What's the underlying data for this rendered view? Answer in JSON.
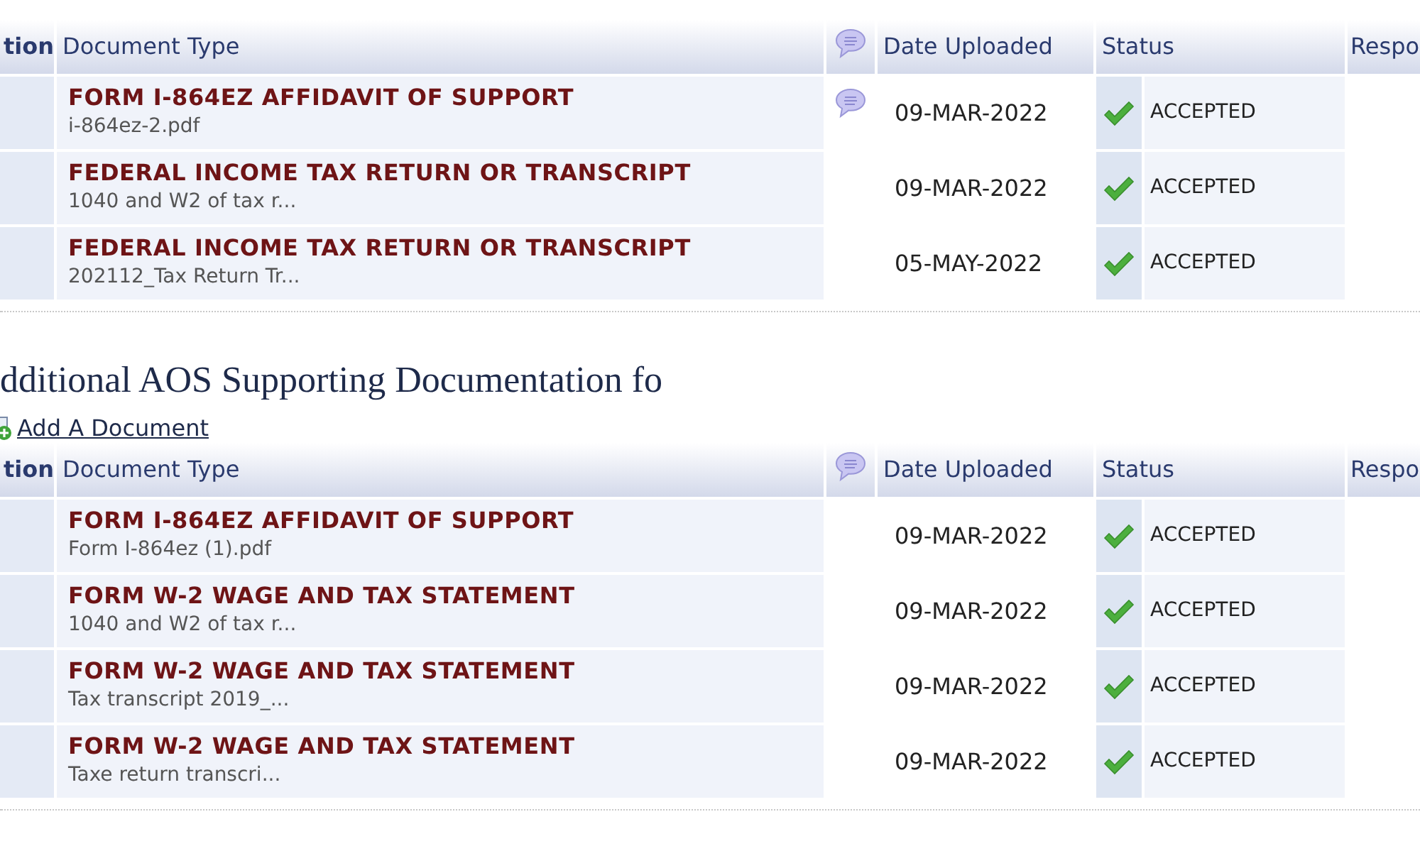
{
  "tables": [
    {
      "columns": [
        "tion",
        "Document Type",
        "",
        "Date Uploaded",
        "Status",
        "Respo"
      ],
      "rows": [
        {
          "document_type": "FORM I-864EZ AFFIDAVIT OF SUPPORT",
          "file": "i-864ez-2.pdf",
          "has_comment": true,
          "date": "09-MAR-2022",
          "status": "ACCEPTED",
          "accepted": true
        },
        {
          "document_type": "FEDERAL INCOME TAX RETURN OR TRANSCRIPT",
          "file": "1040 and W2 of tax r...",
          "has_comment": false,
          "date": "09-MAR-2022",
          "status": "ACCEPTED",
          "accepted": true
        },
        {
          "document_type": "FEDERAL INCOME TAX RETURN OR TRANSCRIPT",
          "file": "202112_Tax Return Tr...",
          "has_comment": false,
          "date": "05-MAY-2022",
          "status": "ACCEPTED",
          "accepted": true
        }
      ]
    },
    {
      "heading": "dditional AOS Supporting Documentation fo",
      "add_link": "Add A Document",
      "columns": [
        "tion",
        "Document Type",
        "",
        "Date Uploaded",
        "Status",
        "Respo"
      ],
      "rows": [
        {
          "document_type": "FORM I-864EZ AFFIDAVIT OF SUPPORT",
          "file": "Form I-864ez (1).pdf",
          "has_comment": false,
          "date": "09-MAR-2022",
          "status": "ACCEPTED",
          "accepted": true
        },
        {
          "document_type": "FORM W-2 WAGE AND TAX STATEMENT",
          "file": "1040 and W2 of tax r...",
          "has_comment": false,
          "date": "09-MAR-2022",
          "status": "ACCEPTED",
          "accepted": true
        },
        {
          "document_type": "FORM W-2 WAGE AND TAX STATEMENT",
          "file": "Tax transcript 2019_...",
          "has_comment": false,
          "date": "09-MAR-2022",
          "status": "ACCEPTED",
          "accepted": true
        },
        {
          "document_type": "FORM W-2 WAGE AND TAX STATEMENT",
          "file": "Taxe return transcri...",
          "has_comment": false,
          "date": "09-MAR-2022",
          "status": "ACCEPTED",
          "accepted": true
        }
      ]
    }
  ]
}
